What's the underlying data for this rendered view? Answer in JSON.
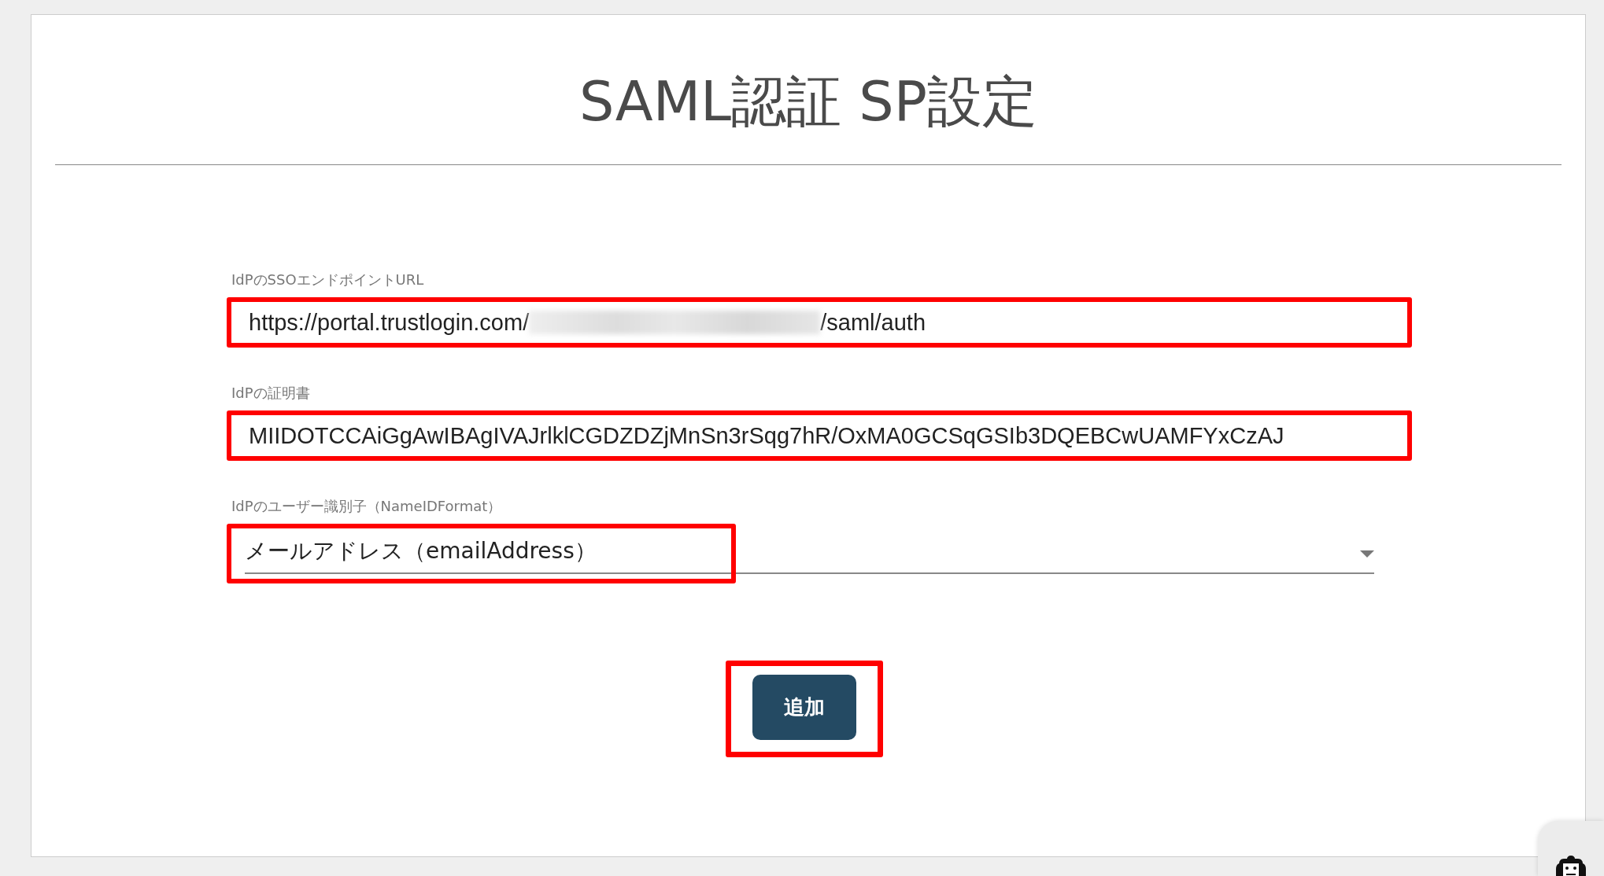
{
  "title": "SAML認証 SP設定",
  "fields": [
    {
      "kind": "text",
      "label": "IdPのSSOエンドポイントURL",
      "value_start": "https://portal.trustlogin.com/",
      "redacted": true,
      "value_end": "/saml/auth",
      "highlighted": true
    },
    {
      "kind": "text",
      "label": "IdPの証明書",
      "value_start": "MIIDOTCCAiGgAwIBAgIVAJrlklCGDZDZjMnSn3rSqg7hR/OxMA0GCSqGSIb3DQEBCwUAMFYxCzAJ",
      "highlighted": true
    },
    {
      "kind": "select",
      "label": "IdPのユーザー識別子（NameIDFormat）",
      "value_start": "メールアドレス（emailAddress）",
      "highlighted": true
    }
  ],
  "button": {
    "label": "追加",
    "highlighted": true
  },
  "chat_widget": {
    "kind": "bot"
  }
}
